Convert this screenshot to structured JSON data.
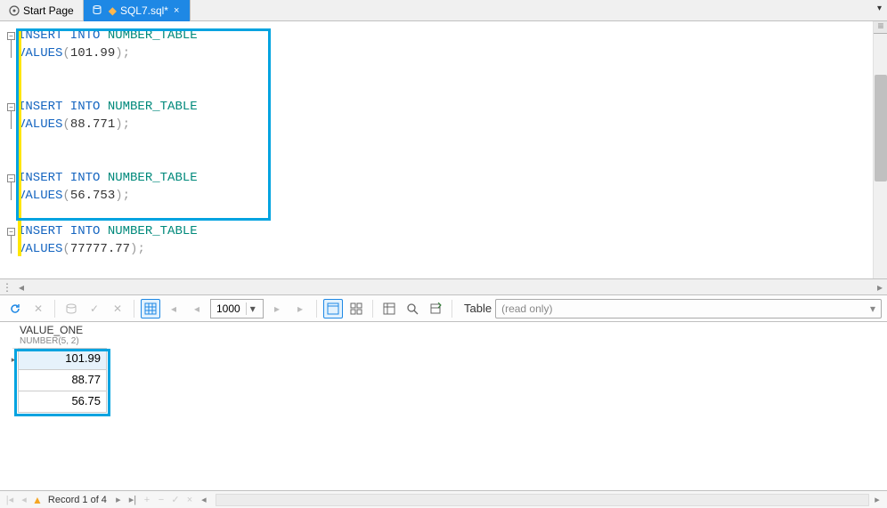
{
  "tabs": {
    "start": "Start Page",
    "file": "SQL7.sql*"
  },
  "editor": {
    "stmt1a": "INSERT INTO",
    "stmt1b": "NUMBER_TABLE",
    "stmt1c": "VALUES",
    "val1": "101.99",
    "val2": "88.771",
    "val3": "56.753",
    "val4": "77777.77"
  },
  "toolbar": {
    "page_size": "1000",
    "mode_label": "Table",
    "mode_value": "(read only)"
  },
  "grid": {
    "col_name": "VALUE_ONE",
    "col_type": "NUMBER(5, 2)",
    "rows": [
      "101.99",
      "88.77",
      "56.75"
    ]
  },
  "status": {
    "record": "Record 1 of 4"
  }
}
